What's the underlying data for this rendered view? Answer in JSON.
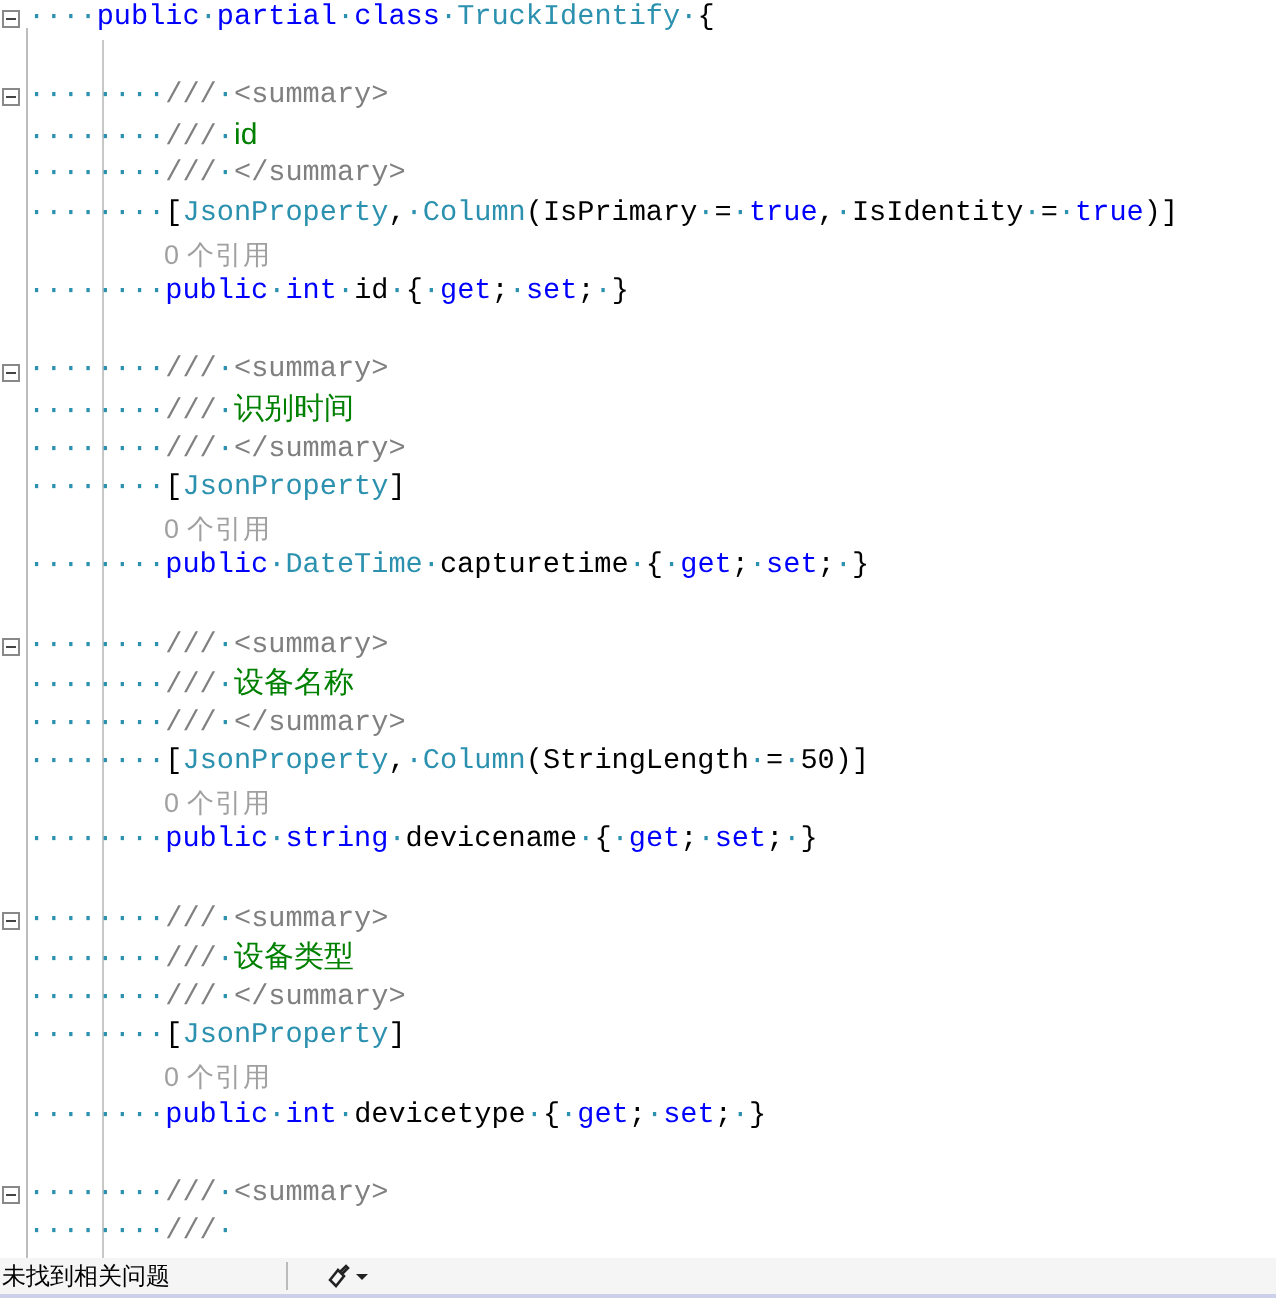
{
  "editor": {
    "lines": [
      {
        "kind": "code",
        "fold": true,
        "tokens": [
          {
            "kind": "plain",
            "text": "····"
          },
          {
            "kind": "keyword",
            "text": "public"
          },
          {
            "kind": "plain",
            "text": "·"
          },
          {
            "kind": "keyword",
            "text": "partial"
          },
          {
            "kind": "plain",
            "text": "·"
          },
          {
            "kind": "keyword",
            "text": "class"
          },
          {
            "kind": "plain",
            "text": "·"
          },
          {
            "kind": "type",
            "text": "TruckIdentify"
          },
          {
            "kind": "plain",
            "text": "·{"
          }
        ]
      },
      {
        "kind": "blank"
      },
      {
        "kind": "code",
        "fold": true,
        "tokens": [
          {
            "kind": "plain",
            "text": "········"
          },
          {
            "kind": "doc",
            "text": "///·<summary>"
          }
        ]
      },
      {
        "kind": "code",
        "fold": false,
        "tokens": [
          {
            "kind": "plain",
            "text": "········"
          },
          {
            "kind": "doc",
            "text": "///·"
          },
          {
            "kind": "comment",
            "text": "id"
          }
        ]
      },
      {
        "kind": "code",
        "fold": false,
        "tokens": [
          {
            "kind": "plain",
            "text": "········"
          },
          {
            "kind": "doc",
            "text": "///·</summary>"
          }
        ]
      },
      {
        "kind": "code",
        "fold": false,
        "tokens": [
          {
            "kind": "plain",
            "text": "········["
          },
          {
            "kind": "type",
            "text": "JsonProperty"
          },
          {
            "kind": "plain",
            "text": ",·"
          },
          {
            "kind": "type",
            "text": "Column"
          },
          {
            "kind": "plain",
            "text": "(IsPrimary·=·"
          },
          {
            "kind": "keyword",
            "text": "true"
          },
          {
            "kind": "plain",
            "text": ",·IsIdentity·=·"
          },
          {
            "kind": "keyword",
            "text": "true"
          },
          {
            "kind": "plain",
            "text": ")]"
          }
        ]
      },
      {
        "kind": "lens",
        "fold": false,
        "text": "0 个引用"
      },
      {
        "kind": "code",
        "fold": false,
        "tokens": [
          {
            "kind": "plain",
            "text": "········"
          },
          {
            "kind": "keyword",
            "text": "public"
          },
          {
            "kind": "plain",
            "text": "·"
          },
          {
            "kind": "keyword",
            "text": "int"
          },
          {
            "kind": "plain",
            "text": "·id·{·"
          },
          {
            "kind": "keyword",
            "text": "get"
          },
          {
            "kind": "plain",
            "text": ";·"
          },
          {
            "kind": "keyword",
            "text": "set"
          },
          {
            "kind": "plain",
            "text": ";·}"
          }
        ]
      },
      {
        "kind": "blank"
      },
      {
        "kind": "code",
        "fold": true,
        "tokens": [
          {
            "kind": "plain",
            "text": "········"
          },
          {
            "kind": "doc",
            "text": "///·<summary>"
          }
        ]
      },
      {
        "kind": "code",
        "fold": false,
        "tokens": [
          {
            "kind": "plain",
            "text": "········"
          },
          {
            "kind": "doc",
            "text": "///·"
          },
          {
            "kind": "comment",
            "text": "识别时间"
          }
        ]
      },
      {
        "kind": "code",
        "fold": false,
        "tokens": [
          {
            "kind": "plain",
            "text": "········"
          },
          {
            "kind": "doc",
            "text": "///·</summary>"
          }
        ]
      },
      {
        "kind": "code",
        "fold": false,
        "tokens": [
          {
            "kind": "plain",
            "text": "········["
          },
          {
            "kind": "type",
            "text": "JsonProperty"
          },
          {
            "kind": "plain",
            "text": "]"
          }
        ]
      },
      {
        "kind": "lens",
        "fold": false,
        "text": "0 个引用"
      },
      {
        "kind": "code",
        "fold": false,
        "tokens": [
          {
            "kind": "plain",
            "text": "········"
          },
          {
            "kind": "keyword",
            "text": "public"
          },
          {
            "kind": "plain",
            "text": "·"
          },
          {
            "kind": "type",
            "text": "DateTime"
          },
          {
            "kind": "plain",
            "text": "·capturetime·{·"
          },
          {
            "kind": "keyword",
            "text": "get"
          },
          {
            "kind": "plain",
            "text": ";·"
          },
          {
            "kind": "keyword",
            "text": "set"
          },
          {
            "kind": "plain",
            "text": ";·}"
          }
        ]
      },
      {
        "kind": "blank"
      },
      {
        "kind": "code",
        "fold": true,
        "tokens": [
          {
            "kind": "plain",
            "text": "········"
          },
          {
            "kind": "doc",
            "text": "///·<summary>"
          }
        ]
      },
      {
        "kind": "code",
        "fold": false,
        "tokens": [
          {
            "kind": "plain",
            "text": "········"
          },
          {
            "kind": "doc",
            "text": "///·"
          },
          {
            "kind": "comment",
            "text": "设备名称"
          }
        ]
      },
      {
        "kind": "code",
        "fold": false,
        "tokens": [
          {
            "kind": "plain",
            "text": "········"
          },
          {
            "kind": "doc",
            "text": "///·</summary>"
          }
        ]
      },
      {
        "kind": "code",
        "fold": false,
        "tokens": [
          {
            "kind": "plain",
            "text": "········["
          },
          {
            "kind": "type",
            "text": "JsonProperty"
          },
          {
            "kind": "plain",
            "text": ",·"
          },
          {
            "kind": "type",
            "text": "Column"
          },
          {
            "kind": "plain",
            "text": "(StringLength·=·50)]"
          }
        ]
      },
      {
        "kind": "lens",
        "fold": false,
        "text": "0 个引用"
      },
      {
        "kind": "code",
        "fold": false,
        "tokens": [
          {
            "kind": "plain",
            "text": "········"
          },
          {
            "kind": "keyword",
            "text": "public"
          },
          {
            "kind": "plain",
            "text": "·"
          },
          {
            "kind": "keyword",
            "text": "string"
          },
          {
            "kind": "plain",
            "text": "·devicename·{·"
          },
          {
            "kind": "keyword",
            "text": "get"
          },
          {
            "kind": "plain",
            "text": ";·"
          },
          {
            "kind": "keyword",
            "text": "set"
          },
          {
            "kind": "plain",
            "text": ";·}"
          }
        ]
      },
      {
        "kind": "blank"
      },
      {
        "kind": "code",
        "fold": true,
        "tokens": [
          {
            "kind": "plain",
            "text": "········"
          },
          {
            "kind": "doc",
            "text": "///·<summary>"
          }
        ]
      },
      {
        "kind": "code",
        "fold": false,
        "tokens": [
          {
            "kind": "plain",
            "text": "········"
          },
          {
            "kind": "doc",
            "text": "///·"
          },
          {
            "kind": "comment",
            "text": "设备类型"
          }
        ]
      },
      {
        "kind": "code",
        "fold": false,
        "tokens": [
          {
            "kind": "plain",
            "text": "········"
          },
          {
            "kind": "doc",
            "text": "///·</summary>"
          }
        ]
      },
      {
        "kind": "code",
        "fold": false,
        "tokens": [
          {
            "kind": "plain",
            "text": "········["
          },
          {
            "kind": "type",
            "text": "JsonProperty"
          },
          {
            "kind": "plain",
            "text": "]"
          }
        ]
      },
      {
        "kind": "lens",
        "fold": false,
        "text": "0 个引用"
      },
      {
        "kind": "code",
        "fold": false,
        "tokens": [
          {
            "kind": "plain",
            "text": "········"
          },
          {
            "kind": "keyword",
            "text": "public"
          },
          {
            "kind": "plain",
            "text": "·"
          },
          {
            "kind": "keyword",
            "text": "int"
          },
          {
            "kind": "plain",
            "text": "·devicetype·{·"
          },
          {
            "kind": "keyword",
            "text": "get"
          },
          {
            "kind": "plain",
            "text": ";·"
          },
          {
            "kind": "keyword",
            "text": "set"
          },
          {
            "kind": "plain",
            "text": ";·}"
          }
        ]
      },
      {
        "kind": "blank"
      },
      {
        "kind": "code",
        "fold": true,
        "tokens": [
          {
            "kind": "plain",
            "text": "········"
          },
          {
            "kind": "doc",
            "text": "///·<summary>"
          }
        ]
      },
      {
        "kind": "code",
        "fold": false,
        "tokens": [
          {
            "kind": "plain",
            "text": "········"
          },
          {
            "kind": "doc",
            "text": "///·"
          }
        ]
      }
    ]
  },
  "status_bar": {
    "message": "未找到相关问题"
  }
}
